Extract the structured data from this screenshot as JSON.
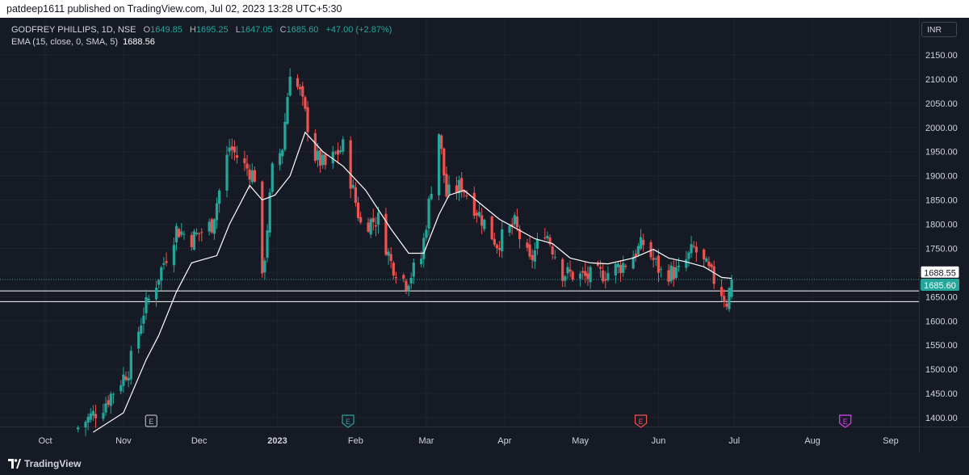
{
  "header": {
    "published_text": "patdeep1611 published on TradingView.com, Jul 02, 2023 13:28 UTC+5:30"
  },
  "legend": {
    "symbol": "GODFREY PHILLIPS, 1D, NSE",
    "open_label": "O",
    "open": "1649.85",
    "high_label": "H",
    "high": "1695.25",
    "low_label": "L",
    "low": "1647.05",
    "close_label": "C",
    "close": "1685.60",
    "change": "+47.00 (+2.87%)",
    "ema_label": "EMA (15, close, 0, SMA, 5)",
    "ema_value": "1688.56"
  },
  "currency": "INR",
  "footer": {
    "brand": "TradingView"
  },
  "colors": {
    "up": "#26a69a",
    "down": "#ef5350",
    "ema": "#ffffff",
    "background": "#161a25",
    "grid": "#20242f",
    "earnings_gray": "#b2b5be",
    "earnings_teal": "#26a69a",
    "earnings_red": "#ef5350",
    "earnings_purple": "#e040fb"
  },
  "chart_data": {
    "type": "candlestick",
    "title": "GODFREY PHILLIPS, 1D, NSE",
    "ylim": [
      1375,
      2175
    ],
    "y_ticks": [
      1400,
      1450,
      1500,
      1550,
      1600,
      1650,
      1700,
      1750,
      1800,
      1850,
      1900,
      1950,
      2000,
      2050,
      2100,
      2150
    ],
    "y_tick_labels": [
      "1400.00",
      "1450.00",
      "1500.00",
      "1550.00",
      "1600.00",
      "1650.00",
      "1700.00",
      "1750.00",
      "1800.00",
      "1850.00",
      "1900.00",
      "1950.00",
      "2000.00",
      "2050.00",
      "2100.00",
      "2150.00"
    ],
    "x_range": [
      "2022-09-25",
      "2023-09-30"
    ],
    "x_ticks": [
      {
        "date": "2022-10-01",
        "label": "Oct"
      },
      {
        "date": "2022-11-01",
        "label": "Nov"
      },
      {
        "date": "2022-12-01",
        "label": "Dec"
      },
      {
        "date": "2023-01-01",
        "label": "2023"
      },
      {
        "date": "2023-02-01",
        "label": "Feb"
      },
      {
        "date": "2023-03-01",
        "label": "Mar"
      },
      {
        "date": "2023-04-01",
        "label": "Apr"
      },
      {
        "date": "2023-05-01",
        "label": "May"
      },
      {
        "date": "2023-06-01",
        "label": "Jun"
      },
      {
        "date": "2023-07-01",
        "label": "Jul"
      },
      {
        "date": "2023-08-01",
        "label": "Aug"
      },
      {
        "date": "2023-09-01",
        "label": "Sep"
      }
    ],
    "price_labels": [
      {
        "value": 1688.55,
        "label": "1688.55",
        "kind": "ema"
      },
      {
        "value": 1685.6,
        "label": "1685.60",
        "kind": "last"
      }
    ],
    "horizontal_lines": [
      1662,
      1640
    ],
    "earnings_markers": [
      {
        "date": "2022-11-12",
        "label": "E",
        "color": "gray"
      },
      {
        "date": "2023-01-29",
        "label": "E",
        "color": "teal"
      },
      {
        "date": "2023-05-25",
        "label": "E",
        "color": "red"
      },
      {
        "date": "2023-08-14",
        "label": "E",
        "color": "purple"
      }
    ],
    "series_close_keypoints": [
      [
        "2022-10-14",
        1380
      ],
      [
        "2022-10-24",
        1425
      ],
      [
        "2022-11-03",
        1500
      ],
      [
        "2022-11-09",
        1620
      ],
      [
        "2022-11-14",
        1680
      ],
      [
        "2022-11-22",
        1790
      ],
      [
        "2022-11-28",
        1770
      ],
      [
        "2022-12-06",
        1800
      ],
      [
        "2022-12-13",
        1960
      ],
      [
        "2022-12-19",
        1920
      ],
      [
        "2022-12-23",
        1900
      ],
      [
        "2022-12-26",
        1680
      ],
      [
        "2022-12-30",
        1910
      ],
      [
        "2023-01-03",
        1960
      ],
      [
        "2023-01-06",
        2120
      ],
      [
        "2023-01-10",
        2070
      ],
      [
        "2023-01-16",
        1940
      ],
      [
        "2023-01-20",
        1920
      ],
      [
        "2023-01-27",
        1960
      ],
      [
        "2023-02-03",
        1800
      ],
      [
        "2023-02-10",
        1810
      ],
      [
        "2023-02-15",
        1720
      ],
      [
        "2023-02-21",
        1680
      ],
      [
        "2023-02-27",
        1730
      ],
      [
        "2023-03-06",
        1990
      ],
      [
        "2023-03-09",
        1860
      ],
      [
        "2023-03-15",
        1880
      ],
      [
        "2023-03-22",
        1820
      ],
      [
        "2023-03-29",
        1760
      ],
      [
        "2023-04-05",
        1800
      ],
      [
        "2023-04-11",
        1720
      ],
      [
        "2023-04-17",
        1790
      ],
      [
        "2023-04-24",
        1700
      ],
      [
        "2023-05-03",
        1690
      ],
      [
        "2023-05-12",
        1700
      ],
      [
        "2023-05-19",
        1720
      ],
      [
        "2023-05-26",
        1760
      ],
      [
        "2023-06-02",
        1700
      ],
      [
        "2023-06-09",
        1700
      ],
      [
        "2023-06-15",
        1750
      ],
      [
        "2023-06-20",
        1710
      ],
      [
        "2023-06-26",
        1660
      ],
      [
        "2023-06-28",
        1640
      ],
      [
        "2023-06-30",
        1686
      ]
    ],
    "ema_keypoints": [
      [
        "2022-10-20",
        1370
      ],
      [
        "2022-11-01",
        1410
      ],
      [
        "2022-11-10",
        1520
      ],
      [
        "2022-11-15",
        1570
      ],
      [
        "2022-11-22",
        1660
      ],
      [
        "2022-11-28",
        1720
      ],
      [
        "2022-12-08",
        1735
      ],
      [
        "2022-12-13",
        1800
      ],
      [
        "2022-12-21",
        1880
      ],
      [
        "2022-12-26",
        1850
      ],
      [
        "2022-12-31",
        1860
      ],
      [
        "2023-01-06",
        1900
      ],
      [
        "2023-01-12",
        1990
      ],
      [
        "2023-01-19",
        1950
      ],
      [
        "2023-01-27",
        1920
      ],
      [
        "2023-02-05",
        1870
      ],
      [
        "2023-02-15",
        1790
      ],
      [
        "2023-02-22",
        1740
      ],
      [
        "2023-02-28",
        1740
      ],
      [
        "2023-03-06",
        1820
      ],
      [
        "2023-03-10",
        1860
      ],
      [
        "2023-03-16",
        1870
      ],
      [
        "2023-03-23",
        1840
      ],
      [
        "2023-03-30",
        1810
      ],
      [
        "2023-04-06",
        1790
      ],
      [
        "2023-04-13",
        1770
      ],
      [
        "2023-04-20",
        1760
      ],
      [
        "2023-04-27",
        1730
      ],
      [
        "2023-05-05",
        1720
      ],
      [
        "2023-05-12",
        1718
      ],
      [
        "2023-05-22",
        1730
      ],
      [
        "2023-05-30",
        1748
      ],
      [
        "2023-06-05",
        1730
      ],
      [
        "2023-06-12",
        1722
      ],
      [
        "2023-06-19",
        1712
      ],
      [
        "2023-06-26",
        1690
      ],
      [
        "2023-06-30",
        1688
      ]
    ]
  }
}
